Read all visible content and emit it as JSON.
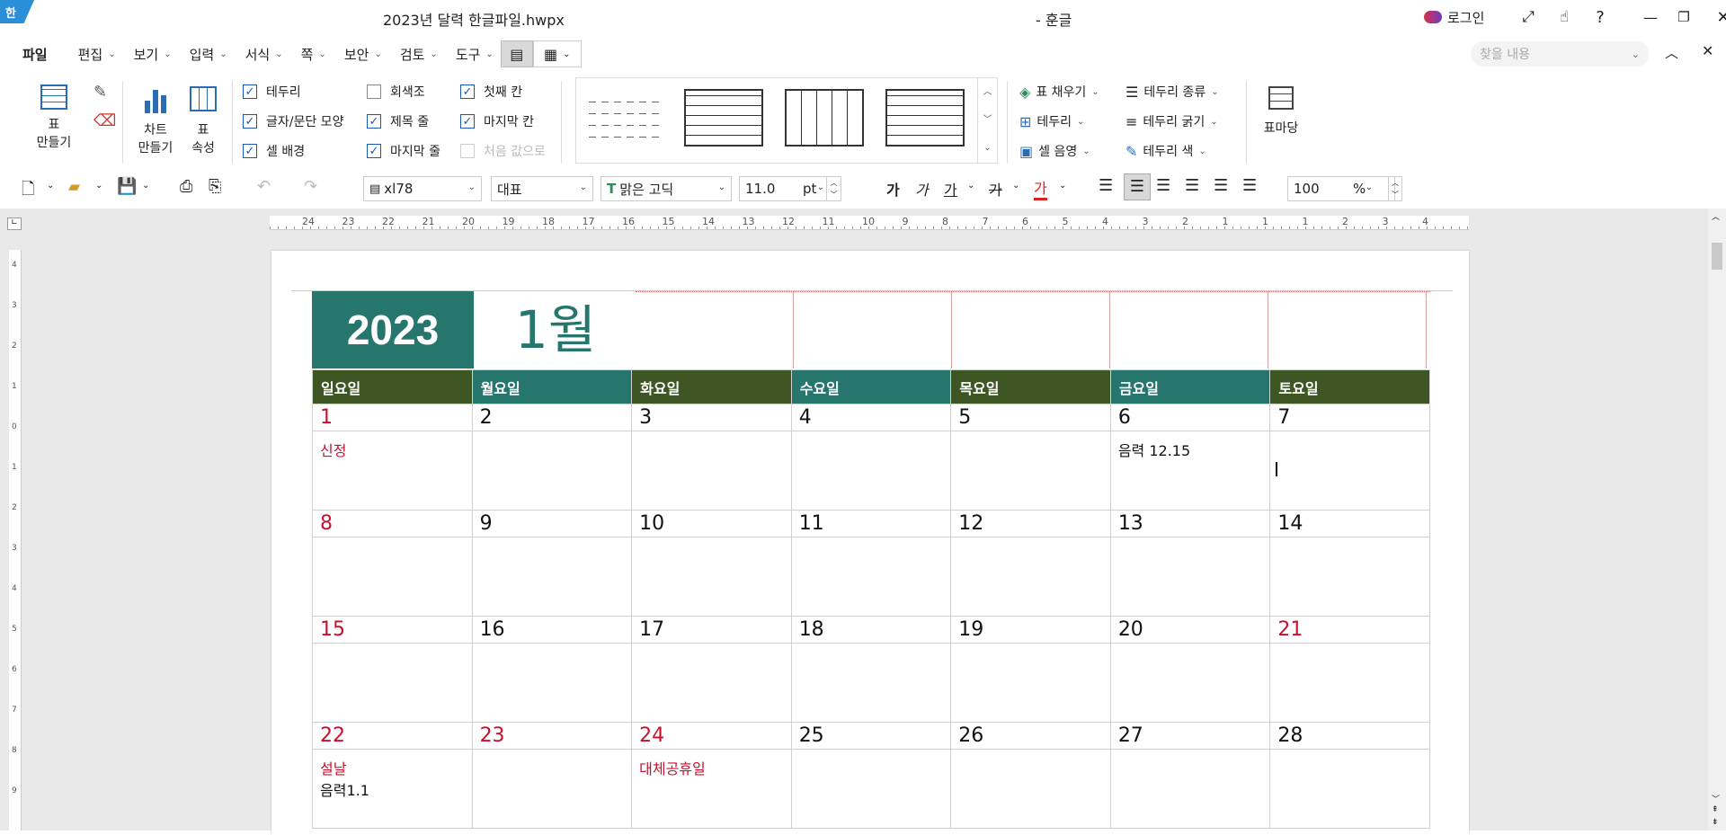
{
  "titlebar": {
    "logo_text": "한",
    "doc_title": "2023년 달력 한글파일.hwpx",
    "app_title": "- 훈글",
    "login_label": "로그인"
  },
  "menubar": {
    "items": [
      "파일",
      "편집",
      "보기",
      "입력",
      "서식",
      "쪽",
      "보안",
      "검토",
      "도구"
    ],
    "search_placeholder": "찾을 내용"
  },
  "ribbon": {
    "table_make": "표\n만들기",
    "table_make_line1": "표",
    "table_make_line2": "만들기",
    "chart_make_line1": "차트",
    "chart_make_line2": "만들기",
    "table_prop_line1": "표",
    "table_prop_line2": "속성",
    "checkboxes": {
      "border": {
        "label": "테두리",
        "checked": true
      },
      "char_para_shape": {
        "label": "글자/문단 모양",
        "checked": true
      },
      "cell_bg": {
        "label": "셀 배경",
        "checked": true
      },
      "grayscale": {
        "label": "회색조",
        "checked": false
      },
      "title_row": {
        "label": "제목 줄",
        "checked": true
      },
      "last_row": {
        "label": "마지막 줄",
        "checked": true
      },
      "first_col": {
        "label": "첫째 칸",
        "checked": true
      },
      "last_col": {
        "label": "마지막 칸",
        "checked": true
      },
      "initial_value": {
        "label": "처음 값으로",
        "checked": false
      }
    },
    "table_fill": "표 채우기",
    "border_btn": "테두리",
    "cell_shade": "셀 음영",
    "border_type": "테두리 종류",
    "border_thickness": "테두리 굵기",
    "border_color": "테두리 색",
    "table_madang": "표마당"
  },
  "toolbar": {
    "style_value": "xl78",
    "lang_value": "대표",
    "font_value": "맑은 고딕",
    "size_value": "11.0",
    "size_unit": "pt",
    "zoom_value": "100",
    "zoom_unit": "%",
    "bold_glyph": "가",
    "italic_glyph": "가",
    "underline_glyph": "가",
    "strike_glyph": "가",
    "color_glyph": "가"
  },
  "ruler": {
    "h_numbers": [
      "24",
      "23",
      "22",
      "21",
      "20",
      "19",
      "18",
      "17",
      "16",
      "15",
      "14",
      "13",
      "12",
      "11",
      "10",
      "9",
      "8",
      "7",
      "6",
      "5",
      "4",
      "3",
      "2",
      "1",
      "1",
      "1",
      "2",
      "3",
      "4"
    ],
    "v_numbers": [
      "4",
      "3",
      "2",
      "1",
      "0",
      "1",
      "2",
      "3",
      "4",
      "5",
      "6",
      "7",
      "8",
      "9"
    ]
  },
  "calendar": {
    "year": "2023",
    "month": "1월",
    "weekdays": [
      "일요일",
      "월요일",
      "화요일",
      "수요일",
      "목요일",
      "금요일",
      "토요일"
    ],
    "weekday_colors": [
      "#3e5623",
      "#26766e",
      "#3e5623",
      "#26766e",
      "#3e5623",
      "#26766e",
      "#3e5623"
    ],
    "year_bg": "#26766e",
    "month_color": "#26766e",
    "holiday_red": "#c8102e",
    "weeks": [
      {
        "days": [
          "1",
          "2",
          "3",
          "4",
          "5",
          "6",
          "7"
        ],
        "red": [
          true,
          false,
          false,
          false,
          false,
          false,
          false
        ],
        "notes": [
          "신정",
          "",
          "",
          "",
          "",
          "음력 12.15",
          ""
        ]
      },
      {
        "days": [
          "8",
          "9",
          "10",
          "11",
          "12",
          "13",
          "14"
        ],
        "red": [
          true,
          false,
          false,
          false,
          false,
          false,
          false
        ],
        "notes": [
          "",
          "",
          "",
          "",
          "",
          "",
          ""
        ]
      },
      {
        "days": [
          "15",
          "16",
          "17",
          "18",
          "19",
          "20",
          "21"
        ],
        "red": [
          true,
          false,
          false,
          false,
          false,
          false,
          true
        ],
        "notes": [
          "",
          "",
          "",
          "",
          "",
          "",
          ""
        ]
      },
      {
        "days": [
          "22",
          "23",
          "24",
          "25",
          "26",
          "27",
          "28"
        ],
        "red": [
          true,
          true,
          true,
          false,
          false,
          false,
          false
        ],
        "notes": [
          "설날",
          "",
          "대체공휴일",
          "",
          "",
          "",
          ""
        ]
      }
    ],
    "lunar_22": "음력1.1"
  }
}
